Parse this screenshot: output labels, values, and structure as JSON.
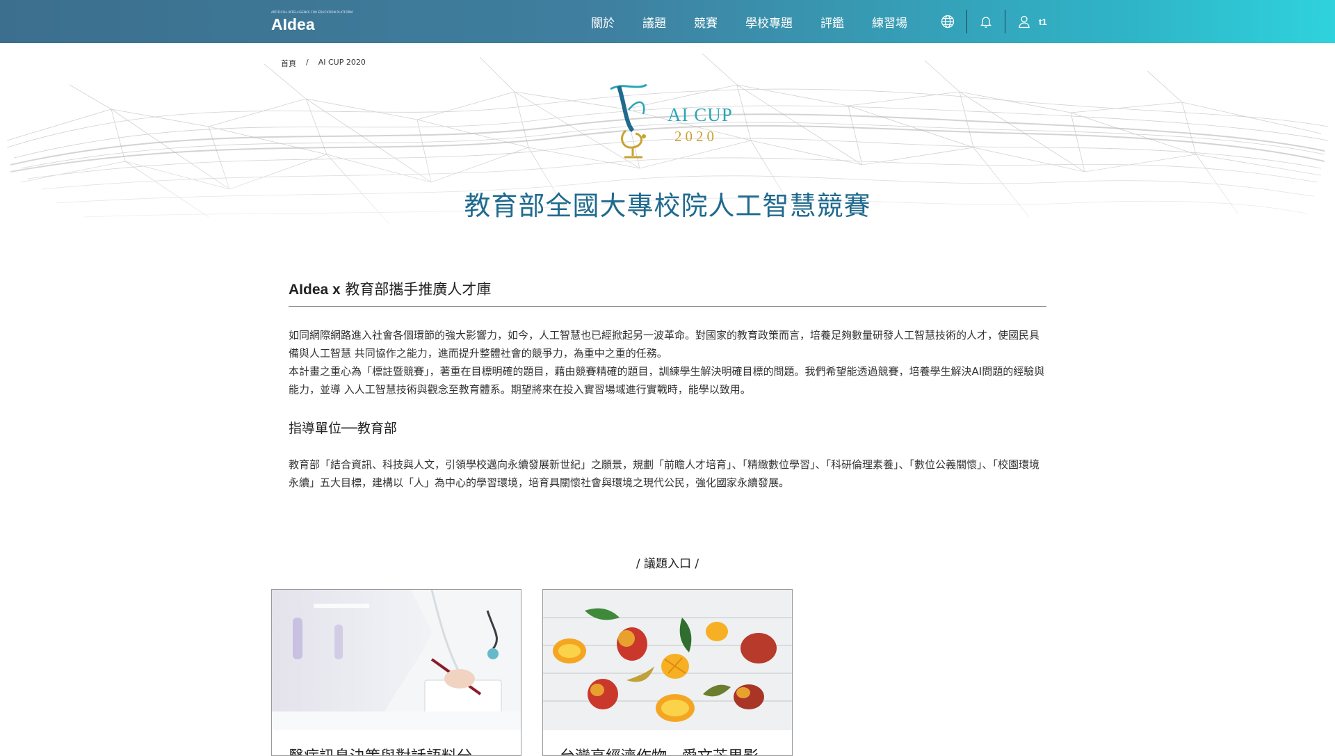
{
  "brand": {
    "logo_small_text": "ARTIFICIAL INTELLIGENCE FOR EDUCATION PLATFORM",
    "logo_word": "AIdea"
  },
  "nav": {
    "items": [
      "關於",
      "議題",
      "競賽",
      "學校專題",
      "評鑑",
      "練習場"
    ],
    "user_name": "t1"
  },
  "breadcrumb": [
    "首頁",
    "/",
    "AI CUP 2020"
  ],
  "hero": {
    "logo_line1": "AI CUP",
    "logo_line2": "2020",
    "title": "教育部全國大專校院人工智慧競賽"
  },
  "content": {
    "section_title_bold": "AIdea x",
    "section_title_rest": " 教育部攜手推廣人才庫",
    "paragraph1": "如同網際網路進入社會各個環節的強大影響力，如今，人工智慧也已經掀起另一波革命。對國家的教育政策而言，培養足夠數量研發人工智慧技術的人才，使國民具備與人工智慧 共同協作之能力，進而提升整體社會的競爭力，為重中之重的任務。",
    "paragraph2": "本計畫之重心為「標註暨競賽」，著重在目標明確的題目，藉由競賽精確的題目，訓練學生解決明確目標的問題。我們希望能透過競賽，培養學生解決AI問題的經驗與能力，並導 入人工智慧技術與觀念至教育體系。期望將來在投入實習場域進行實戰時，能學以致用。",
    "subtitle": "指導單位──教育部",
    "paragraph3": "教育部「結合資訊、科技與人文，引領學校邁向永續發展新世紀」之願景，規劃「前瞻人才培育」、「精緻數位學習」、「科研倫理素養」、「數位公義關懷」、「校園環境永續」五大目標，建構以「人」為中心的學習環境，培育具關懷社會與環境之現代公民，強化國家永續發展。"
  },
  "topics": {
    "heading": "/ 議題入口 /",
    "cards": [
      {
        "title": "醫病訊息決策與對話語料分"
      },
      {
        "title": "台灣高經濟作物 - 愛文芒果影"
      }
    ]
  }
}
